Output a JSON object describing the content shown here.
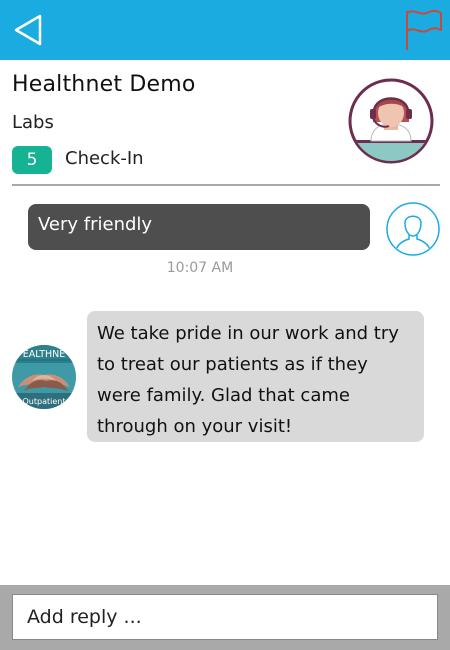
{
  "topbar": {
    "back_icon": "back-triangle-icon",
    "flag_icon": "flag-icon",
    "bg_color": "#1aace0"
  },
  "header": {
    "business_name": "Healthnet Demo",
    "department": "Labs",
    "rating": "5",
    "rating_color": "#16b294",
    "tag": "Check-In",
    "avatar_icon": "agent-headset-avatar"
  },
  "conversation": {
    "outgoing": {
      "text": "Very friendly",
      "time": "10:07 AM",
      "avatar_icon": "user-silhouette-icon"
    },
    "incoming": {
      "text": "We take pride in our work and try to treat our patients as if they were family. Glad that came through on your visit!",
      "avatar_top_text": "EALTHNE",
      "avatar_bottom_text": "Outpatient"
    }
  },
  "reply": {
    "placeholder": "Add reply ..."
  }
}
